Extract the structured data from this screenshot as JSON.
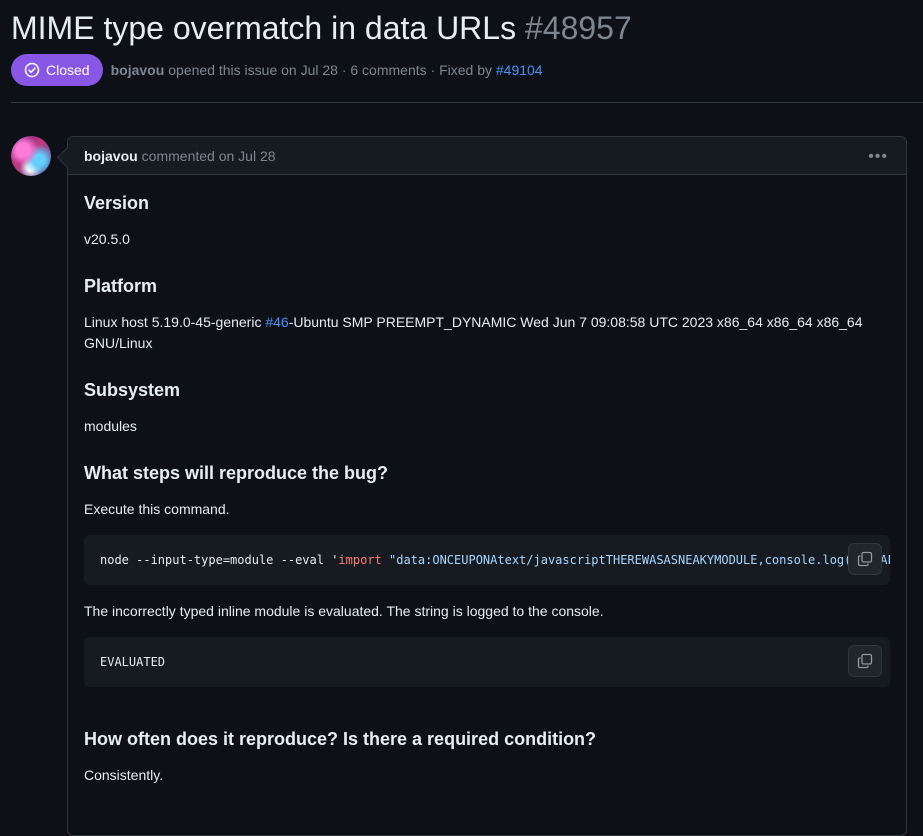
{
  "issue": {
    "title": "MIME type overmatch in data URLs",
    "number": "#48957",
    "state": "Closed",
    "author": "bojavou",
    "opened_text": "opened this issue on Jul 28 · 6 comments · Fixed by",
    "fixed_by": "#49104"
  },
  "comment": {
    "author": "bojavou",
    "meta": "commented on Jul 28",
    "menu": "•••",
    "sections": {
      "version_heading": "Version",
      "version_value": "v20.5.0",
      "platform_heading": "Platform",
      "platform_prefix": "Linux host 5.19.0-45-generic ",
      "platform_link": "#46",
      "platform_suffix": "-Ubuntu SMP PREEMPT_DYNAMIC Wed Jun 7 09:08:58 UTC 2023 x86_64 x86_64 x86_64 GNU/Linux",
      "subsystem_heading": "Subsystem",
      "subsystem_value": "modules",
      "steps_heading": "What steps will reproduce the bug?",
      "steps_text": "Execute this command.",
      "code1_prefix": "node --input-type=module --eval '",
      "code1_kw": "import",
      "code1_str": " \"data:ONCEUPONAtext/javascriptTHEREWASASNEAKYMODULE,console.log(\\\"EVALUATED\\\")\"'",
      "result_text": "The incorrectly typed inline module is evaluated. The string is logged to the console.",
      "code2": "EVALUATED",
      "often_heading": "How often does it reproduce? Is there a required condition?",
      "often_text": "Consistently."
    }
  }
}
